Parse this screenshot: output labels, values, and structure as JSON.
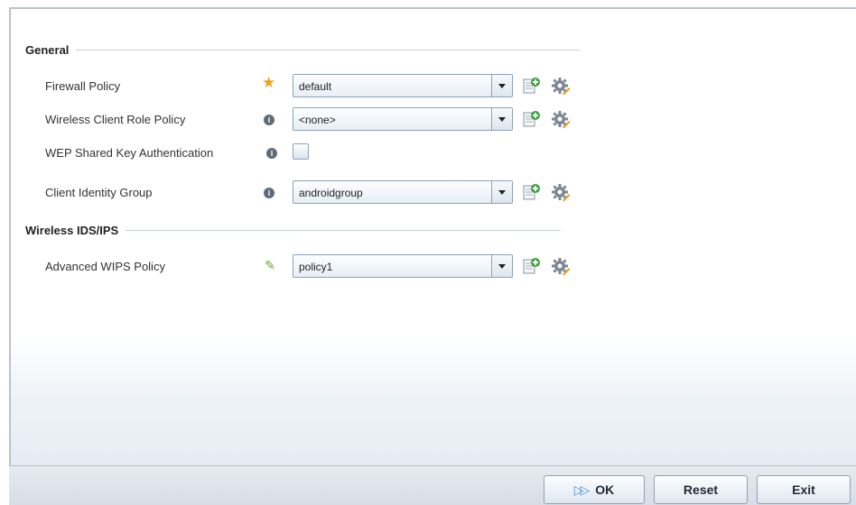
{
  "sections": {
    "general": {
      "title": "General"
    },
    "ids": {
      "title": "Wireless IDS/IPS"
    }
  },
  "rows": {
    "firewall": {
      "label": "Firewall Policy",
      "marker": "required-star",
      "value": "default"
    },
    "role": {
      "label": "Wireless Client Role Policy",
      "marker": "info",
      "value": "<none>"
    },
    "wep": {
      "label": "WEP Shared Key Authentication",
      "marker": "info",
      "checked": false
    },
    "identity": {
      "label": "Client Identity Group",
      "marker": "info",
      "value": "androidgroup"
    },
    "wips": {
      "label": "Advanced WIPS Policy",
      "marker": "pencil",
      "value": "policy1"
    }
  },
  "icons": {
    "info": "i",
    "star": "★",
    "pencil": "✎",
    "add": "add-policy-icon",
    "configure": "gear-icon"
  },
  "footer": {
    "ok_label": "OK",
    "reset_label": "Reset",
    "exit_label": "Exit"
  },
  "colors": {
    "accent": "#4a90d0",
    "required": "#f0a020",
    "pencil": "#6aa43a"
  }
}
